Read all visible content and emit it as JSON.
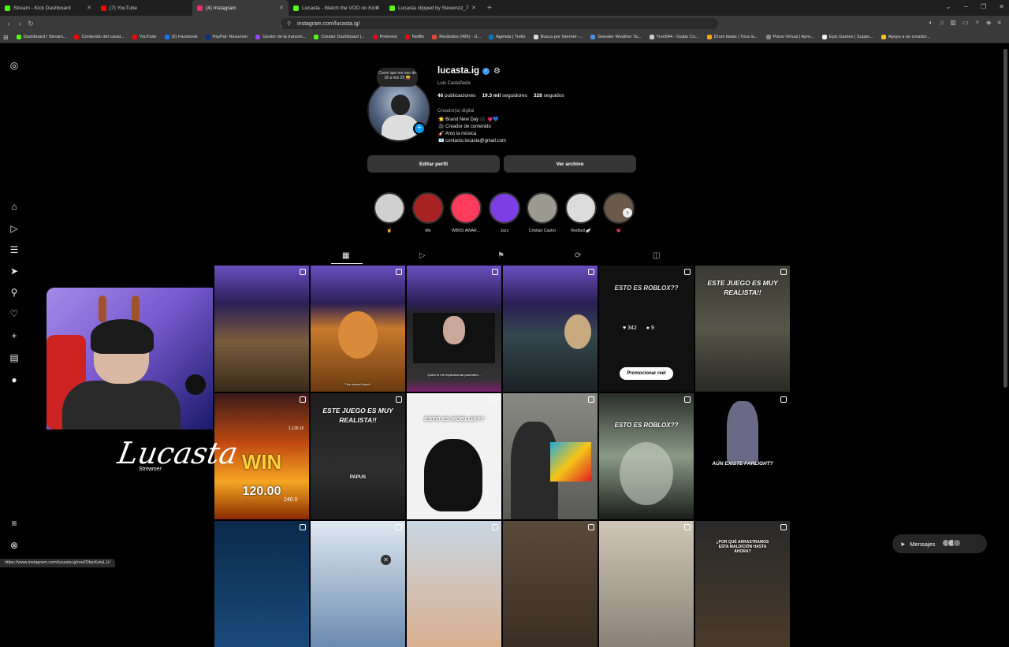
{
  "browser": {
    "tabs": [
      {
        "label": "Stream - Kick Dashboard",
        "color": "#53fc18"
      },
      {
        "label": "(7) YouTube",
        "color": "#ff0000"
      },
      {
        "label": "(4) Instagram",
        "color": "#e1306c"
      },
      {
        "label": "Lucasta - Watch the VOD on Kick",
        "color": "#53fc18"
      },
      {
        "label": "Lucasta clipped by Stevenzz_7",
        "color": "#53fc18"
      }
    ],
    "url": "instagram.com/lucasta.ig/",
    "bookmarks": [
      "Dashboard / Stream...",
      "Contenido del canal...",
      "YouTube",
      "(2) Facebook",
      "PayPal: Resumen",
      "Gestor de la transmi...",
      "Creator Dashboard |...",
      "Pinterest",
      "Netflix",
      "Recibidos (495) - cl...",
      "Agenda | Trello",
      "Busca por Internet -...",
      "Sweater Weather Ta...",
      "Tron544 - Guitar Co...",
      "Drum beats | Toca la...",
      "Piano Virtual | Apre...",
      "Epic Games | Suppo...",
      "Apoya a un creador..."
    ],
    "status_url": "https://www.instagram.com/lucasta.ig/reel/DbjcKetuL1i/"
  },
  "profile": {
    "note": "Como que me veo de 18 a mis 25 😝",
    "username": "lucasta.ig",
    "full_name": "Luis Castañeda",
    "stats": {
      "posts": "46",
      "posts_label": "publicaciones",
      "followers": "19.3 mil",
      "followers_label": "seguidores",
      "following": "328",
      "following_label": "seguidos"
    },
    "category": "Creador(a) digital",
    "bio": [
      "🌟 Brand New Day 🕸️ 💗💙",
      "🎥 Creador de contenido",
      "🎸 Amo la música",
      "📧 contacto.lucasta@gmail.com"
    ],
    "edit_label": "Editar perfil",
    "archive_label": "Ver archivo"
  },
  "highlights": [
    {
      "label": "🤘",
      "color": "#cfcfcf"
    },
    {
      "label": "Me",
      "color": "#a82424"
    },
    {
      "label": "WBNS AWAR...",
      "color": "#ff3b5c"
    },
    {
      "label": "Jazz",
      "color": "#7b3fe4"
    },
    {
      "label": "Cristian Castro",
      "color": "#9a9a90"
    },
    {
      "label": "Redbull 🪽",
      "color": "#dcdcdc"
    },
    {
      "label": "💗",
      "color": "#6b5a4a"
    }
  ],
  "grid": {
    "captions": {
      "c5": "ESTO ES ROBLOX??",
      "c6": "ESTE JUEGO ES MUY REALISTA!!",
      "c8": "ESTE JUEGO ES MUY REALISTA!!",
      "c8b": "PAPUS",
      "c9": "ESTO ES ROBLOX??",
      "c11": "ESTO ES ROBLOX??",
      "c12": "AÚN EXISTE FARLIGHT?",
      "c18": "¿POR QUÉ ARRASTRAMOS ESTA MALDICIÓN HASTA AHORA?"
    },
    "hover": {
      "likes": "342",
      "comments": "9",
      "promote_label": "Promocionar reel"
    },
    "slot": {
      "top": "WIN",
      "value": "120.00",
      "side": "240.0",
      "small": "1.126.10"
    },
    "cell_texts": {
      "c1b": "This doesn't have?",
      "c2b": "Quien sí me explicaba las pacientes..."
    }
  },
  "overlay": {
    "logo": "Lucasta",
    "logo_sub": "Streamer"
  },
  "messages_label": "Mensajes"
}
